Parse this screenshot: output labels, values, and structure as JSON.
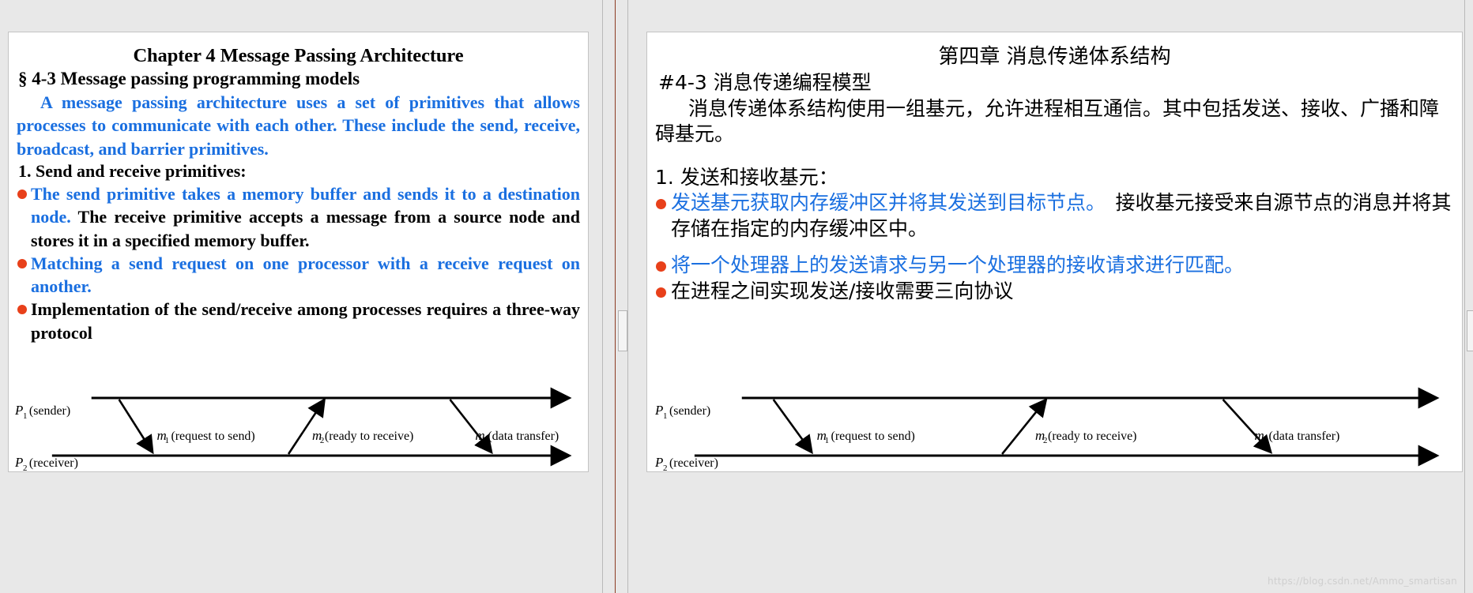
{
  "colors": {
    "blue": "#1A6FE0",
    "bullet_red": "#E8401A",
    "black": "#000000",
    "app_background": "#E8E8E8",
    "slide_background": "#FFFFFF",
    "rail_accent": "#8C3B22",
    "watermark": "#CFCFCF"
  },
  "left_slide": {
    "title": "Chapter 4 Message Passing Architecture",
    "section": "§ 4-3 Message passing programming models",
    "intro": "A message passing architecture uses a set of primitives that allows processes to communicate with each other. These include the send, receive, broadcast, and barrier primitives.",
    "numbered_heading": "1. Send and receive primitives:",
    "bullets": [
      {
        "blue_text": "The send primitive takes a memory buffer and sends it to a destination node.",
        "black_text": " The receive primitive accepts a message from a source node and stores it in a specified memory buffer."
      },
      {
        "blue_text": "Matching a send request on one processor with a receive request on another.",
        "black_text": ""
      },
      {
        "blue_text": "",
        "black_text": "Implementation of the send/receive among processes requires a three-way protocol"
      }
    ]
  },
  "right_slide": {
    "title": "第四章 消息传递体系结构",
    "section_prefix": "#4-3",
    "section": "#4-3 消息传递编程模型",
    "section_rest": " 消息传递编程模型",
    "intro": "消息传递体系结构使用一组基元，允许进程相互通信。其中包括发送、接收、广播和障碍基元。",
    "numbered_heading": "1. 发送和接收基元：",
    "bullets": [
      {
        "blue_text": "发送基元获取内存缓冲区并将其发送到目标节点。",
        "black_text": "　接收基元接受来自源节点的消息并将其存储在指定的内存缓冲区中。"
      },
      {
        "blue_text": "将一个处理器上的发送请求与另一个处理器的接收请求进行匹配。",
        "black_text": ""
      },
      {
        "blue_text": "",
        "black_text": "在进程之间实现发送/接收需要三向协议"
      }
    ]
  },
  "diagram": {
    "type": "sequence",
    "p1_symbol": "P",
    "p1_sub": "1",
    "p1_role": "(sender)",
    "p2_symbol": "P",
    "p2_sub": "2",
    "p2_role": "(receiver)",
    "messages": [
      {
        "symbol": "m",
        "sub": "1",
        "label": "(request to send)",
        "direction": "down"
      },
      {
        "symbol": "m",
        "sub": "2",
        "label": "(ready to receive)",
        "direction": "up"
      },
      {
        "symbol": "m",
        "sub": "3",
        "label": "(data transfer)",
        "direction": "down"
      }
    ]
  },
  "watermark": {
    "text": "https://blog.csdn.net/Ammo_smartisan"
  }
}
